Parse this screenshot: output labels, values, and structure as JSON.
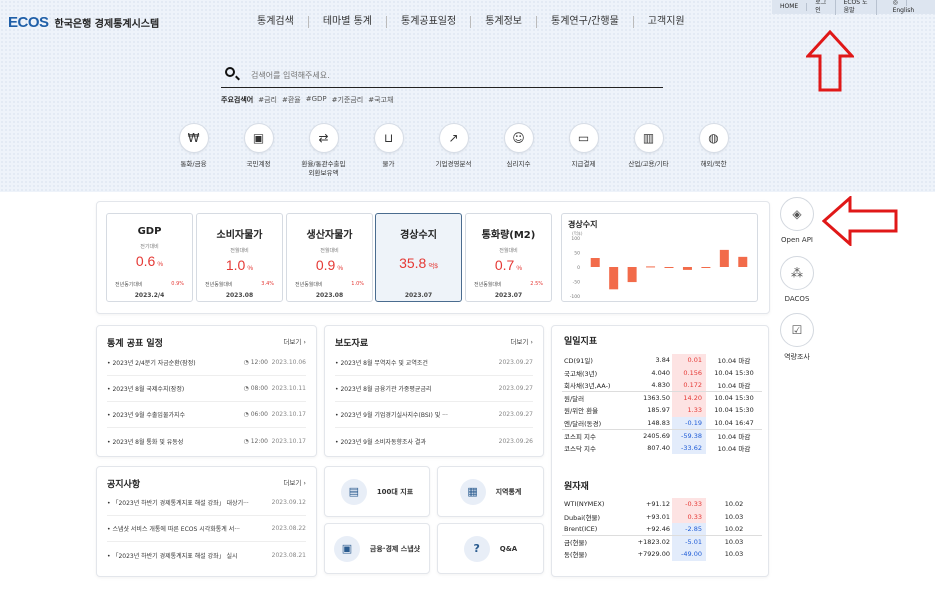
{
  "logo": {
    "mark": "ECOS",
    "text": "한국은행 경제통계시스템"
  },
  "gnb": [
    "통계검색",
    "테마별 통계",
    "통계공표일정",
    "통계정보",
    "통계연구/간행물",
    "고객지원"
  ],
  "util": [
    "HOME",
    "로그인",
    "ECOS 도움말",
    "English"
  ],
  "search": {
    "placeholder": "검색어를 입력해주세요."
  },
  "keywords": {
    "label": "주요검색어",
    "items": [
      "#금리",
      "#환율",
      "#GDP",
      "#기준금리",
      "#국고채"
    ]
  },
  "categories": [
    {
      "label": "통화/금융",
      "icon": "currency-icon"
    },
    {
      "label": "국민계정",
      "icon": "wallet-icon"
    },
    {
      "label": "환율/통관수출입\n외환보유액",
      "icon": "exchange-icon"
    },
    {
      "label": "물가",
      "icon": "basket-icon"
    },
    {
      "label": "기업경영분석",
      "icon": "trend-icon"
    },
    {
      "label": "심리지수",
      "icon": "head-icon"
    },
    {
      "label": "지급결제",
      "icon": "atm-icon"
    },
    {
      "label": "산업/고용/기타",
      "icon": "building-icon"
    },
    {
      "label": "해외/북한",
      "icon": "globe-icon"
    }
  ],
  "kpis": [
    {
      "title": "GDP",
      "sub": "전기대비",
      "value": "0.6",
      "unit": "%",
      "rlabel": "전년동기대비",
      "rval": "0.9%",
      "date": "2023.2/4"
    },
    {
      "title": "소비자물가",
      "sub": "전월대비",
      "value": "1.0",
      "unit": "%",
      "rlabel": "전년동월대비",
      "rval": "3.4%",
      "date": "2023.08"
    },
    {
      "title": "생산자물가",
      "sub": "전월대비",
      "value": "0.9",
      "unit": "%",
      "rlabel": "전년동월대비",
      "rval": "1.0%",
      "date": "2023.08"
    },
    {
      "title": "경상수지",
      "sub": "",
      "value": "35.8",
      "unit": "억$",
      "rlabel": "",
      "rval": "",
      "date": "2023.07"
    },
    {
      "title": "통화량(M2)",
      "sub": "전월대비",
      "value": "0.7",
      "unit": "%",
      "rlabel": "전년동월대비",
      "rval": "2.5%",
      "date": "2023.07"
    }
  ],
  "chart_data": {
    "type": "bar",
    "title": "경상수지",
    "unit": "(억$)",
    "yticks": [
      "100",
      "50",
      "0",
      "-50",
      "-100"
    ],
    "ylim": [
      -100,
      100
    ],
    "values": [
      31,
      -77,
      -52,
      2,
      -1,
      -10,
      0,
      59,
      35
    ],
    "color": "#f26b4a"
  },
  "side": [
    {
      "label": "Open API",
      "icon": "layers-icon"
    },
    {
      "label": "DACOS",
      "icon": "shapes-icon"
    },
    {
      "label": "역량조사",
      "icon": "survey-icon"
    }
  ],
  "release": {
    "title": "통계 공표 일정",
    "more": "더보기",
    "rows": [
      {
        "text": "• 2023년 2/4분기 자금순환(잠정)",
        "time": "12:00",
        "date": "2023.10.06"
      },
      {
        "text": "• 2023년 8월 국제수지(잠정)",
        "time": "08:00",
        "date": "2023.10.11"
      },
      {
        "text": "• 2023년 9월 수출입물가지수",
        "time": "06:00",
        "date": "2023.10.17"
      },
      {
        "text": "• 2023년 8월 통화 및 유동성",
        "time": "12:00",
        "date": "2023.10.17"
      }
    ]
  },
  "press": {
    "title": "보도자료",
    "more": "더보기",
    "rows": [
      {
        "text": "• 2023년 8월 무역지수 및 교역조건",
        "date": "2023.09.27"
      },
      {
        "text": "• 2023년 8월 금융기관 가중평균금리",
        "date": "2023.09.27"
      },
      {
        "text": "• 2023년 9월 기업경기실사지수(BSI) 및 ···",
        "date": "2023.09.27"
      },
      {
        "text": "• 2023년 9월 소비자동향조사 결과",
        "date": "2023.09.26"
      }
    ]
  },
  "notice": {
    "title": "공지사항",
    "more": "더보기",
    "rows": [
      {
        "text": "• 「2023년 하반기 경제통계지표 해설 강좌」 대상기···",
        "date": "2023.09.12"
      },
      {
        "text": "• 스냅샷 서비스 개통에 따른 ECOS 시각화통계 서···",
        "date": "2023.08.22"
      },
      {
        "text": "• 「2023년 하반기 경제통계지표 해설 강좌」 실시",
        "date": "2023.08.21"
      }
    ]
  },
  "tiles": [
    "100대 지표",
    "지역통계",
    "금융·경제 스냅샷",
    "Q&A"
  ],
  "daily": {
    "title": "일일지표",
    "rows": [
      {
        "name": "CD(91일)",
        "val": "3.84",
        "chg": "0.01",
        "dir": "up",
        "date": "10.04 마감",
        "sep": false
      },
      {
        "name": "국고채(3년)",
        "val": "4.040",
        "chg": "0.156",
        "dir": "up",
        "date": "10.04 15:30",
        "sep": false
      },
      {
        "name": "회사채(3년,AA-)",
        "val": "4.830",
        "chg": "0.172",
        "dir": "up",
        "date": "10.04 마감",
        "sep": false
      },
      {
        "name": "원/달러",
        "val": "1363.50",
        "chg": "14.20",
        "dir": "up",
        "date": "10.04 15:30",
        "sep": true
      },
      {
        "name": "원/위안 환율",
        "val": "185.97",
        "chg": "1.33",
        "dir": "up",
        "date": "10.04 15:30",
        "sep": false
      },
      {
        "name": "엔/달러(동경)",
        "val": "148.83",
        "chg": "-0.19",
        "dir": "dn",
        "date": "10.04 16:47",
        "sep": false
      },
      {
        "name": "코스피 지수",
        "val": "2405.69",
        "chg": "-59.38",
        "dir": "dn",
        "date": "10.04 마감",
        "sep": true
      },
      {
        "name": "코스닥 지수",
        "val": "807.40",
        "chg": "-33.62",
        "dir": "dn",
        "date": "10.04 마감",
        "sep": false
      }
    ]
  },
  "commodity": {
    "title": "원자재",
    "rows": [
      {
        "name": "WTI(NYMEX)",
        "val": "+91.12",
        "chg": "-0.33",
        "dir": "up",
        "date": "10.02",
        "sep": false
      },
      {
        "name": "Dubai(현물)",
        "val": "+93.01",
        "chg": "0.33",
        "dir": "up",
        "date": "10.03",
        "sep": false
      },
      {
        "name": "Brent(ICE)",
        "val": "+92.46",
        "chg": "-2.85",
        "dir": "dn",
        "date": "10.02",
        "sep": false
      },
      {
        "name": "금(현물)",
        "val": "+1823.02",
        "chg": "-5.01",
        "dir": "dn",
        "date": "10.03",
        "sep": true
      },
      {
        "name": "동(현물)",
        "val": "+7929.00",
        "chg": "-49.00",
        "dir": "dn",
        "date": "10.03",
        "sep": false
      }
    ]
  }
}
